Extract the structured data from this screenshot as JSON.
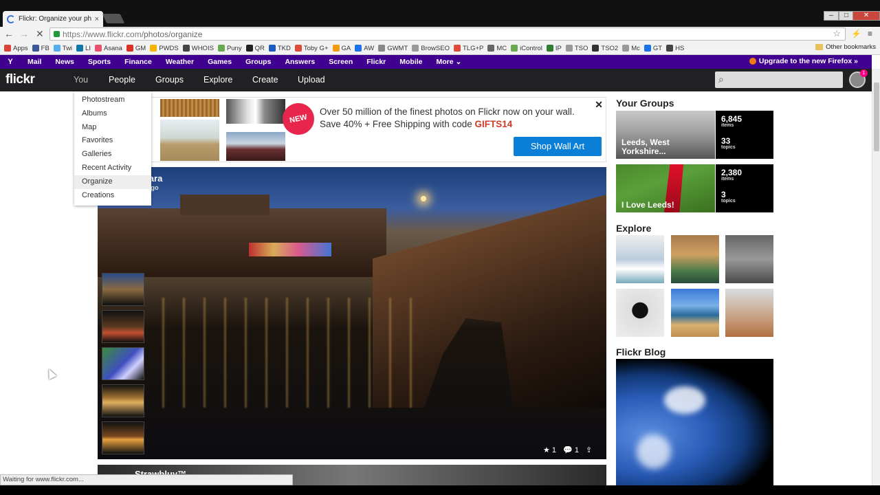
{
  "browser": {
    "tab_title": "Flickr: Organize your photo",
    "tab_close": "×",
    "url_domain": "https://www.flickr.com",
    "url_path": "/photos/organize",
    "win_min": "–",
    "win_max": "□",
    "win_close": "✕"
  },
  "bookmarks": [
    {
      "label": "Apps",
      "color": "#d9453b"
    },
    {
      "label": "FB",
      "color": "#3b5998"
    },
    {
      "label": "Twi",
      "color": "#55acee"
    },
    {
      "label": "LI",
      "color": "#0e76a8"
    },
    {
      "label": "Asana",
      "color": "#e8526c"
    },
    {
      "label": "GM",
      "color": "#d93025"
    },
    {
      "label": "PWDS",
      "color": "#f5b400"
    },
    {
      "label": "WHOIS",
      "color": "#444444"
    },
    {
      "label": "Puny",
      "color": "#6aa84f"
    },
    {
      "label": "QR",
      "color": "#222222"
    },
    {
      "label": "TKD",
      "color": "#1a5bbf"
    },
    {
      "label": "Toby G+",
      "color": "#dd4b39"
    },
    {
      "label": "GA",
      "color": "#f39c12"
    },
    {
      "label": "AW",
      "color": "#1a73e8"
    },
    {
      "label": "GWMT",
      "color": "#888888"
    },
    {
      "label": "BrowSEO",
      "color": "#999999"
    },
    {
      "label": "TLG+P",
      "color": "#dd4b39"
    },
    {
      "label": "MC",
      "color": "#666666"
    },
    {
      "label": "iControl",
      "color": "#6aa84f"
    },
    {
      "label": "IP",
      "color": "#2e7d32"
    },
    {
      "label": "TSO",
      "color": "#999999"
    },
    {
      "label": "TSO2",
      "color": "#333333"
    },
    {
      "label": "Mc",
      "color": "#999999"
    },
    {
      "label": "GT",
      "color": "#1a73e8"
    },
    {
      "label": "HS",
      "color": "#444444"
    }
  ],
  "other_bookmarks": "Other bookmarks",
  "yahoo": {
    "logo": "Y",
    "links": [
      "Mail",
      "News",
      "Sports",
      "Finance",
      "Weather",
      "Games",
      "Groups",
      "Answers",
      "Screen",
      "Flickr",
      "Mobile",
      "More ⌄"
    ],
    "firefox": "Upgrade to the new Firefox »"
  },
  "flickr_nav": {
    "logo": "flickr",
    "items": [
      "You",
      "People",
      "Groups",
      "Explore",
      "Create",
      "Upload"
    ],
    "notif_count": "1"
  },
  "you_menu": [
    "Photostream",
    "Albums",
    "Map",
    "Favorites",
    "Galleries",
    "Recent Activity",
    "Organize",
    "Creations"
  ],
  "ad": {
    "badge": "NEW",
    "line1": "Over 50 million of the finest photos on Flickr now on your wall.",
    "line2": "Save 40% + Free Shipping with code ",
    "code": "GIFTS14",
    "button": "Shop Wall Art",
    "close": "✕"
  },
  "photo": {
    "owner": "...dara",
    "ago": "...s ago",
    "stars": "1",
    "comments": "1"
  },
  "next_photo_owner": "Strawbluy™",
  "status": "Waiting for www.flickr.com...",
  "right": {
    "groups_title": "Your Groups",
    "groups": [
      {
        "name": "Leeds, West Yorkshire...",
        "items": "6,845",
        "items_lbl": "items",
        "topics": "33",
        "topics_lbl": "topics"
      },
      {
        "name": "I Love Leeds!",
        "items": "2,380",
        "items_lbl": "items",
        "topics": "3",
        "topics_lbl": "topics"
      }
    ],
    "explore_title": "Explore",
    "blog_title": "Flickr Blog"
  }
}
